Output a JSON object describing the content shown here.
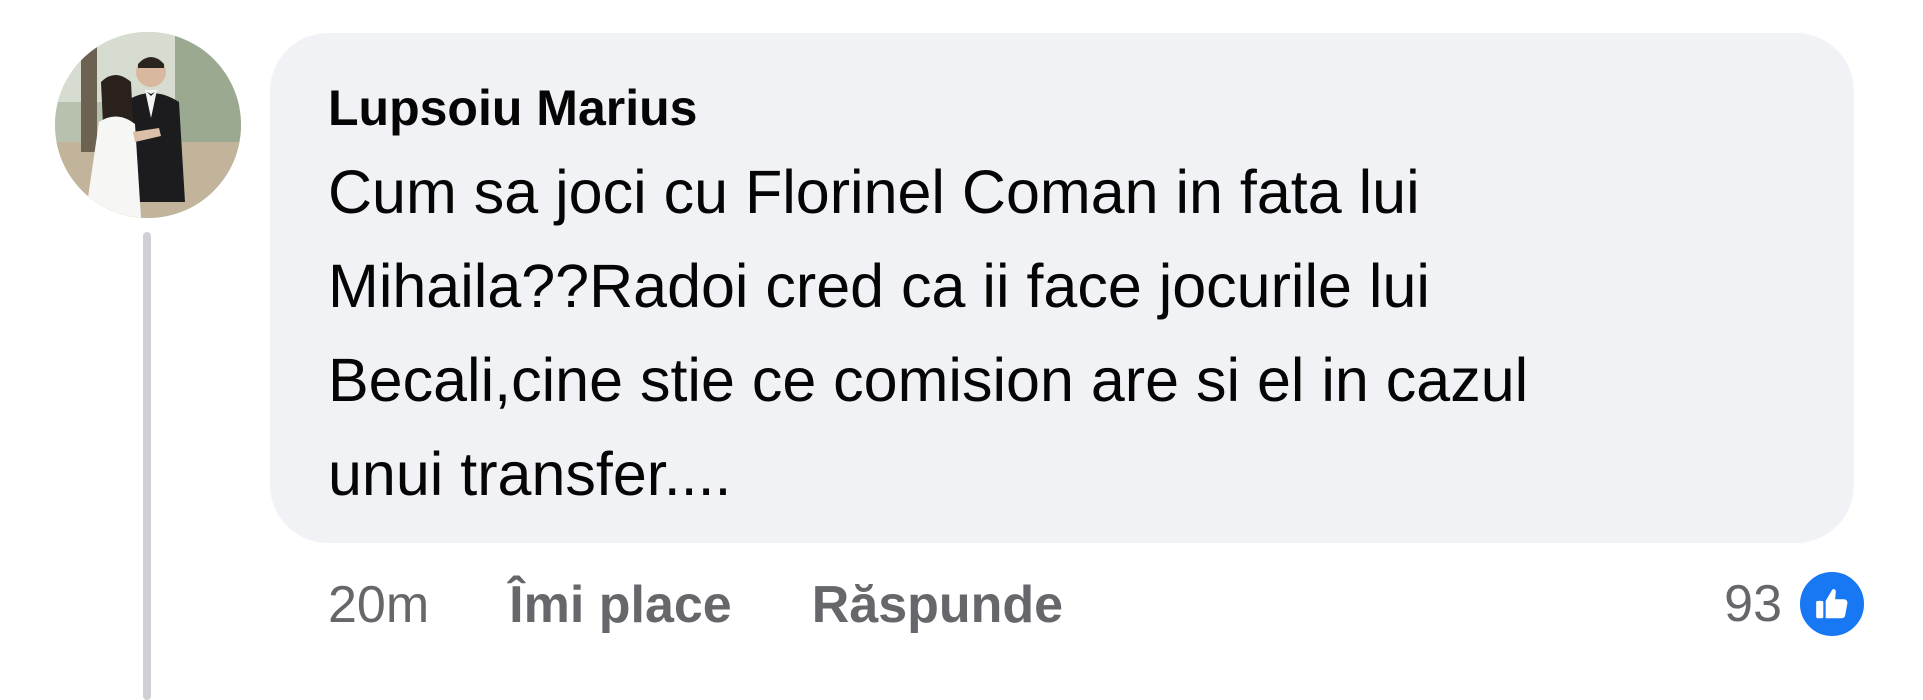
{
  "comment": {
    "author": "Lupsoiu Marius",
    "text": "Cum sa joci cu Florinel Coman in fata lui\nMihaila??Radoi cred ca ii face jocurile lui\nBecali,cine stie ce comision are si el in cazul\nunui transfer....",
    "timestamp": "20m",
    "like_label": "Îmi place",
    "reply_label": "Răspunde",
    "reaction_count": "93",
    "reaction_icon": "like-thumbs-up-icon"
  },
  "colors": {
    "bubble_background": "#f0f2f5",
    "text": "#050505",
    "secondary_text": "#65676b",
    "like_blue": "#1877f2",
    "thread_line": "#ced0d4"
  }
}
